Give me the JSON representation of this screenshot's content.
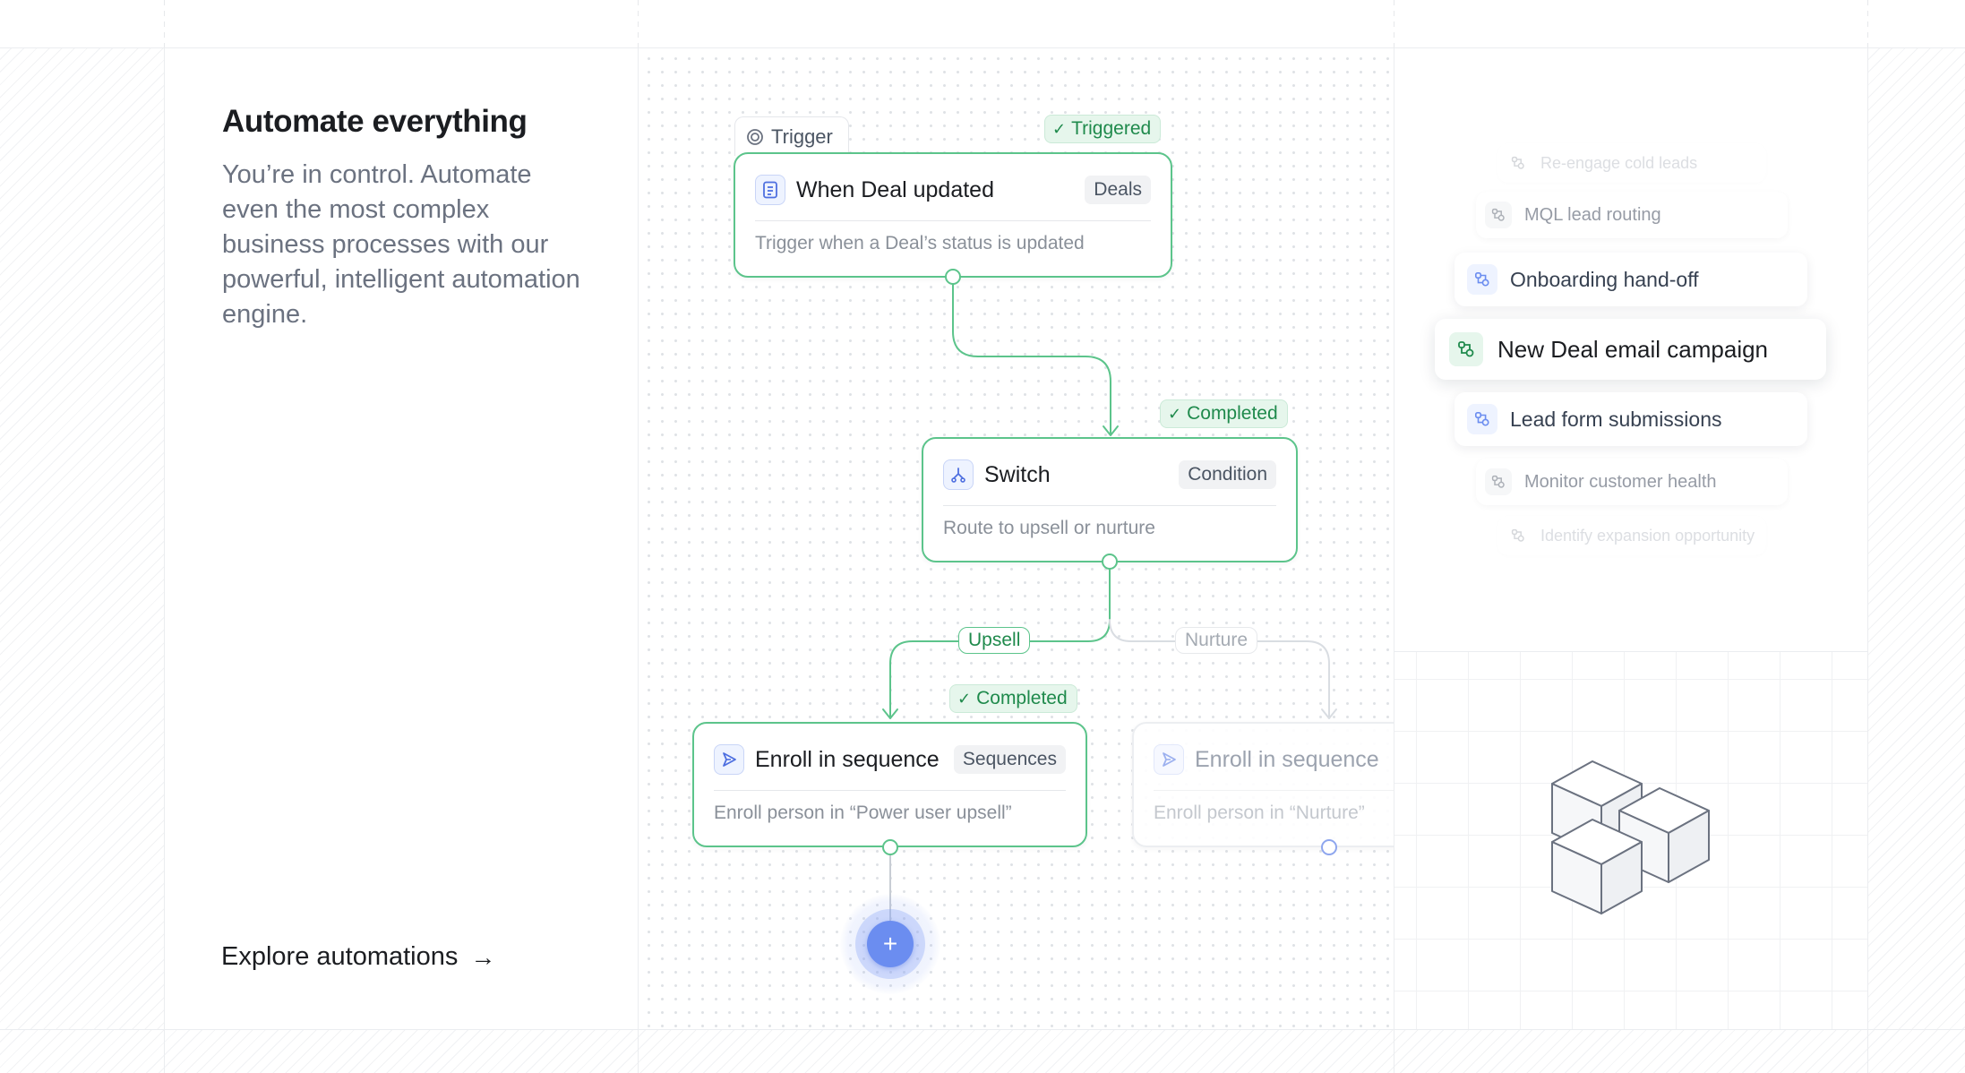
{
  "left": {
    "headline": "Automate everything",
    "subtext": "You’re in control. Automate even the most complex business processes with our powerful, intelligent automation engine.",
    "cta_label": "Explore automations",
    "cta_arrow": "→"
  },
  "flow": {
    "trigger_tab": "Trigger",
    "nodes": [
      {
        "title": "When Deal updated",
        "tag": "Deals",
        "description": "Trigger when a Deal’s status is updated",
        "icon": "document-icon",
        "status": "Triggered"
      },
      {
        "title": "Switch",
        "tag": "Condition",
        "description": "Route to upsell or nurture",
        "icon": "branch-icon",
        "status": "Completed"
      },
      {
        "title": "Enroll in sequence",
        "tag": "Sequences",
        "description": "Enroll person in “Power user upsell”",
        "icon": "send-icon",
        "status": "Completed"
      },
      {
        "title": "Enroll in sequence",
        "tag": "",
        "description": "Enroll person in “Nurture”",
        "icon": "send-icon",
        "status": ""
      }
    ],
    "edge_labels": {
      "upsell": "Upsell",
      "nurture": "Nurture"
    },
    "add_button": "+",
    "colors": {
      "accent_green": "#5cc48b",
      "accent_blue": "#6b8df0"
    }
  },
  "automations": {
    "items": [
      {
        "label": "Re-engage cold leads"
      },
      {
        "label": "MQL lead routing"
      },
      {
        "label": "Onboarding hand-off"
      },
      {
        "label": "New Deal email campaign"
      },
      {
        "label": "Lead form submissions"
      },
      {
        "label": "Monitor customer health"
      },
      {
        "label": "Identify expansion opportunity"
      }
    ]
  }
}
